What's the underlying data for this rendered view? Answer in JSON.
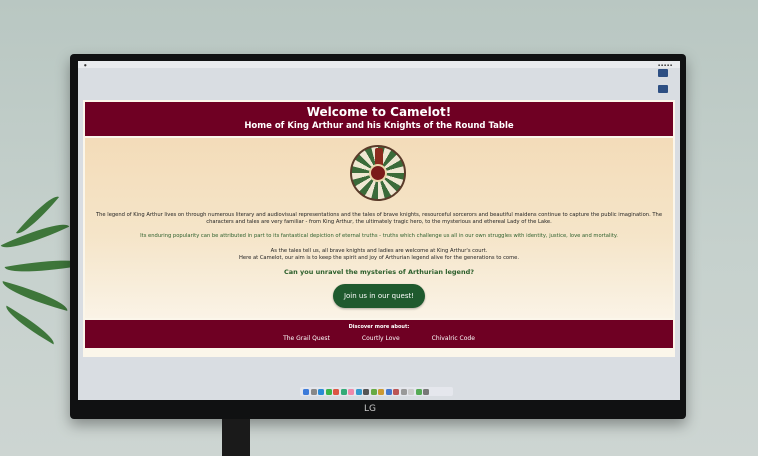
{
  "page": {
    "title": "Welcome to Camelot!",
    "subtitle": "Home of King Arthur and his Knights of the Round Table",
    "intro_1": "The legend of King Arthur lives on through numerous literary and audiovisual representations and the tales of brave knights, resourceful sorcerors and beautiful maidens continue to capture the public imagination. The characters and tales are very familiar - from King Arthur, the ultimately tragic hero, to the mysterious and ethereal Lady of the Lake.",
    "intro_2": "Its enduring popularity can be attributed in part to its fantastical depiction of eternal truths - truths which challenge us all in our own struggles with identity, justice, love and mortality.",
    "intro_3a": "As the tales tell us, all brave knights and ladies are welcome at King Arthur's court.",
    "intro_3b": "Here at Camelot, our aim is to keep the spirit and joy of Arthurian legend alive for the generations to come.",
    "question": "Can you unravel the mysteries of Arthurian legend?",
    "cta": "Join us in our quest!"
  },
  "footer": {
    "title": "Discover more about:",
    "links": [
      "The Grail Quest",
      "Courtly Love",
      "Chivalric Code"
    ]
  },
  "monitor": {
    "brand": "LG"
  },
  "colors": {
    "header": "#6f0023",
    "accent_green": "#2b5e2b",
    "button": "#1f5a2e"
  }
}
